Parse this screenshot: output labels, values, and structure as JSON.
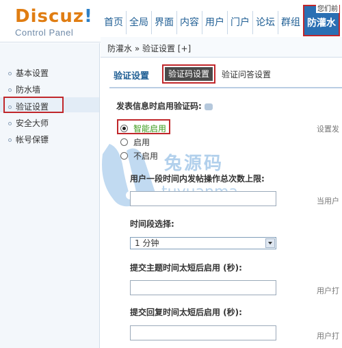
{
  "logo": {
    "brand": "Discuz",
    "brand_tail": "!",
    "subtitle": "Control Panel"
  },
  "top_note": "您们前",
  "nav": {
    "items": [
      "首页",
      "全局",
      "界面",
      "内容",
      "用户",
      "门户",
      "论坛",
      "群组"
    ],
    "active": "防灌水"
  },
  "sidebar": {
    "items": [
      "基本设置",
      "防水墙",
      "验证设置",
      "安全大师",
      "帐号保镖"
    ],
    "selected": "验证设置"
  },
  "breadcrumb": "防灌水 » 验证设置 [+]",
  "main": {
    "title": "验证设置",
    "tabs": [
      "验证码设置",
      "验证问答设置"
    ],
    "enable_label": "发表信息时启用验证码:",
    "radio_options": [
      "智能启用",
      "启用",
      "不启用"
    ],
    "selected_option": "智能启用",
    "field_limit_label": "用户一段时间内发帖操作总次数上限:",
    "field_period_label": "时间段选择:",
    "period_value": "1 分钟",
    "field_topic_label": "提交主题时间太短后启用 (秒):",
    "field_reply_label": "提交回复时间太短后启用 (秒):"
  },
  "hints": [
    "设置发",
    "当用户",
    "用户打",
    "用户打"
  ],
  "watermark": {
    "cn": "兔源码",
    "en": "tuyuanma"
  },
  "colors": {
    "accent": "#2a6fb3",
    "highlight_border": "#c0262a",
    "brand_orange": "#e07d12",
    "option_green": "#3a9a1a"
  }
}
